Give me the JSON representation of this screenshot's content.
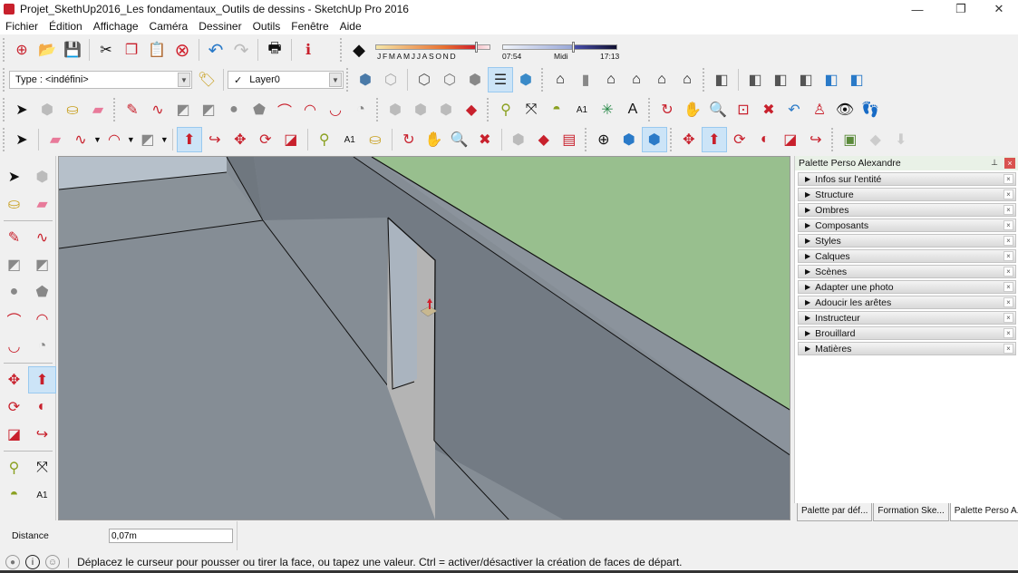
{
  "window": {
    "title": "Projet_SkethUp2016_Les fondamentaux_Outils de dessins - SketchUp Pro 2016",
    "minimize": "—",
    "restore": "❐",
    "close": "✕"
  },
  "menu": [
    "Fichier",
    "Édition",
    "Affichage",
    "Caméra",
    "Dessiner",
    "Outils",
    "Fenêtre",
    "Aide"
  ],
  "toolbar_standard": [
    {
      "name": "new-icon",
      "glyph": "⊕"
    },
    {
      "name": "open-icon",
      "glyph": "📂"
    },
    {
      "name": "save-icon",
      "glyph": "💾"
    },
    {
      "name": "cut-icon",
      "glyph": "✂"
    },
    {
      "name": "copy-icon",
      "glyph": "❐"
    },
    {
      "name": "paste-icon",
      "glyph": "📋"
    },
    {
      "name": "delete-icon",
      "glyph": "⊗"
    },
    {
      "name": "undo-icon",
      "glyph": "↶"
    },
    {
      "name": "redo-icon",
      "glyph": "↷"
    },
    {
      "name": "print-icon",
      "glyph": "🖶"
    },
    {
      "name": "model-info-icon",
      "glyph": "ℹ"
    }
  ],
  "shadows": {
    "months": [
      "J",
      "F",
      "M",
      "A",
      "M",
      "J",
      "J",
      "A",
      "S",
      "O",
      "N",
      "D"
    ],
    "month_value": "N",
    "time_start": "07:54",
    "time_mid": "Midi",
    "time_end": "17:13",
    "month_fraction": 0.87,
    "time_fraction": 0.62,
    "gradient_colors": [
      "#f5e6a8",
      "#d0202c"
    ],
    "time_colors": [
      "#e8eef8",
      "#1a1a50"
    ]
  },
  "entity_type": {
    "label": "Type : <indéfini>"
  },
  "layer": {
    "label": "Layer0",
    "check": "✓"
  },
  "viewport": {
    "colors": {
      "ground": "#858d95",
      "wall": "#737b84",
      "wall_top": "#8b939c",
      "grass": "#98bf8e",
      "door": "#aab4bf",
      "door_side": "#b4b4b4",
      "sky": "#b6c0ca"
    }
  },
  "panel": {
    "title": "Palette Perso Alexandre",
    "pin": "⊥",
    "close": "×",
    "trays": [
      "Infos sur l'entité",
      "Structure",
      "Ombres",
      "Composants",
      "Styles",
      "Calques",
      "Scènes",
      "Adapter une photo",
      "Adoucir les arêtes",
      "Instructeur",
      "Brouillard",
      "Matières"
    ],
    "tabs": [
      "Palette par déf...",
      "Formation Ske...",
      "Palette Perso A..."
    ],
    "active_tab": 2
  },
  "vcb": {
    "label": "Distance",
    "value": "0,07m"
  },
  "status": {
    "message": "Déplacez le curseur pour pousser ou tirer la face, ou tapez une valeur.  Ctrl = activer/désactiver la création de faces de départ."
  }
}
